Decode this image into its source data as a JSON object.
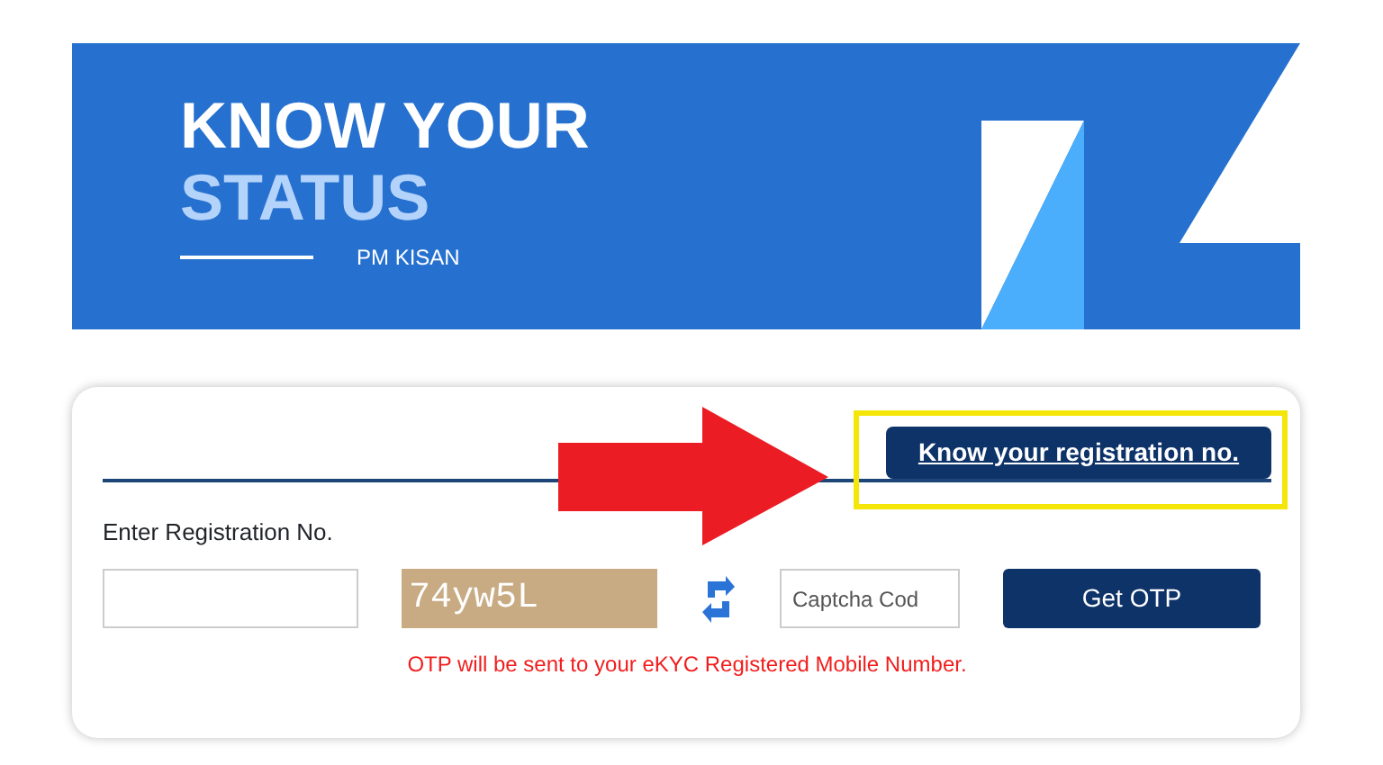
{
  "banner": {
    "title": "KNOW YOUR",
    "highlight": "STATUS",
    "subtitle": "PM KISAN"
  },
  "form": {
    "link_button": "Know your registration no.",
    "label": "Enter Registration No.",
    "captcha_text": "74yw5L",
    "captcha_placeholder": "Captcha Cod",
    "submit": "Get OTP",
    "note": "OTP will be sent to your eKYC Registered Mobile Number."
  }
}
